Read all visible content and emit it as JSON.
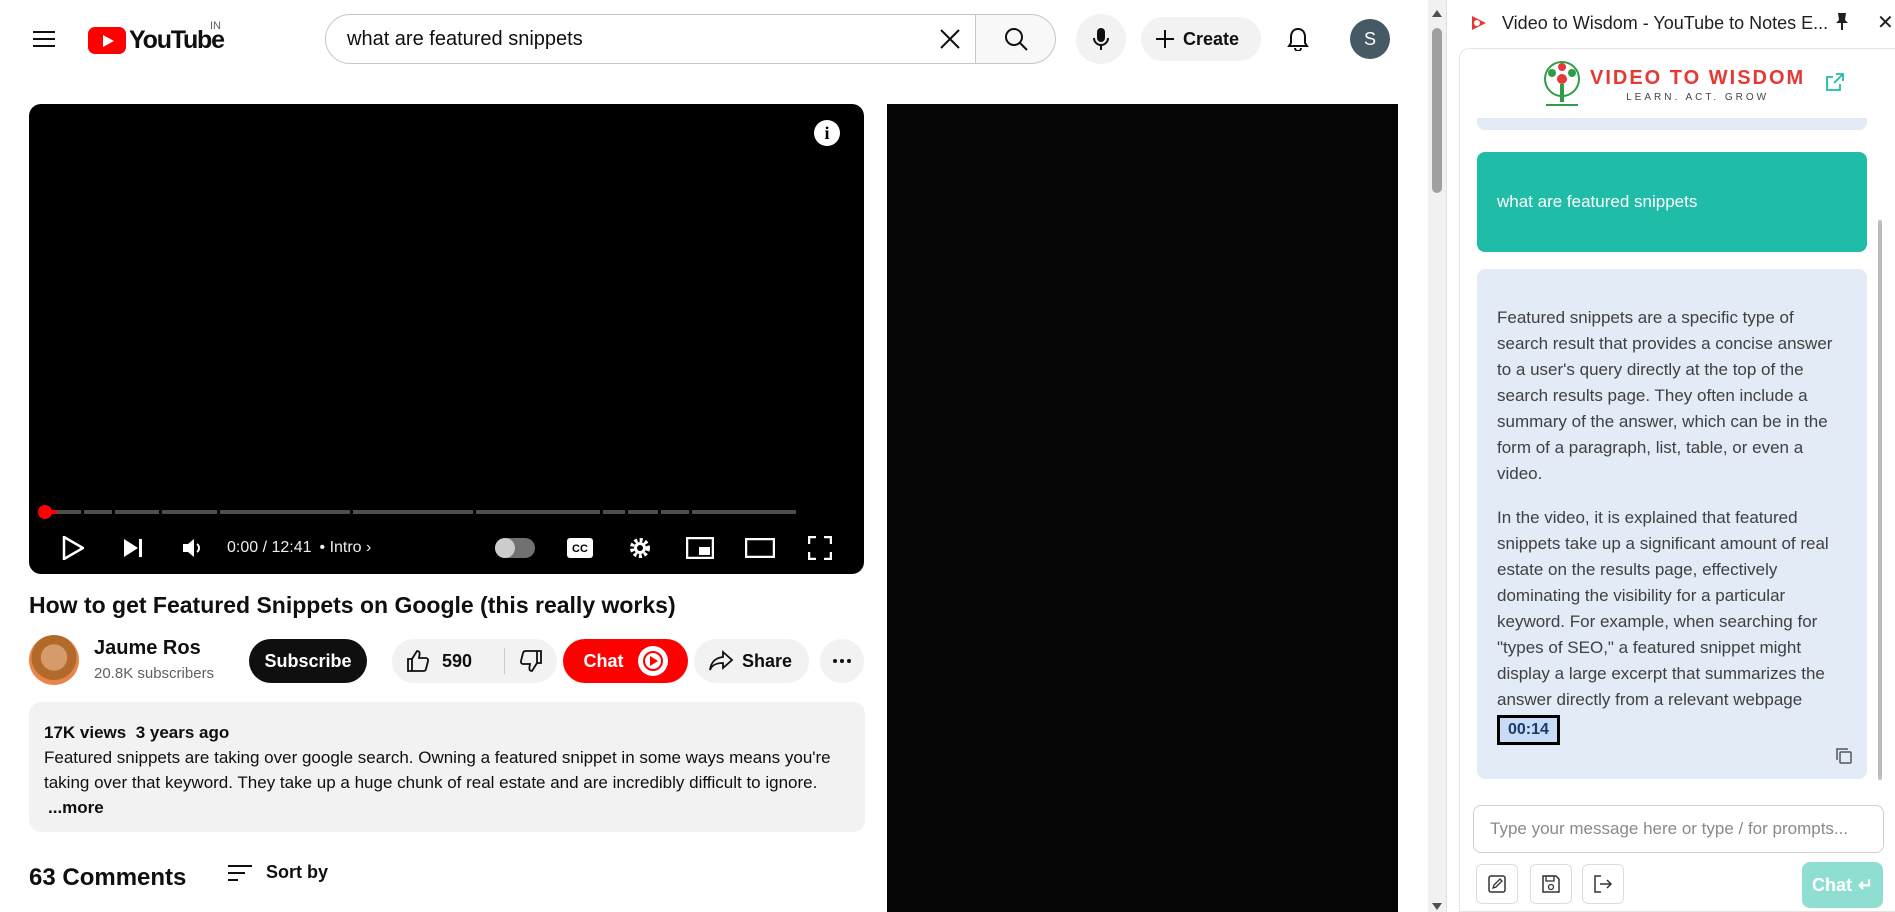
{
  "youtube": {
    "logo_text": "YouTube",
    "country_code": "IN",
    "search": {
      "value": "what are featured snippets"
    },
    "create_label": "Create",
    "account_initial": "S",
    "player": {
      "time": "0:00 / 12:41",
      "chapter": "Intro",
      "progress_fraction": 0.0
    },
    "video": {
      "title": "How to get Featured Snippets on Google (this really works)",
      "channel": "Jaume Ros",
      "subscribers": "20.8K subscribers",
      "subscribe_label": "Subscribe",
      "likes": "590",
      "chat_label": "Chat",
      "share_label": "Share"
    },
    "description": {
      "views": "17K views",
      "age": "3 years ago",
      "text": "Featured snippets are taking over google search. Owning a featured snippet in some ways means you're taking over that keyword. They take up a huge chunk of real estate and are incredibly difficult to ignore.",
      "more_label": "...more"
    },
    "comments": {
      "count_label": "63 Comments",
      "sort_label": "Sort by"
    }
  },
  "extension": {
    "window_title": "Video to Wisdom - YouTube to Notes E...",
    "brand_name": "VIDEO TO WISDOM",
    "brand_tagline": "LEARN. ACT. GROW",
    "user_message": "what are featured snippets",
    "ai_paragraphs": [
      "Featured snippets are a specific type of search result that provides a concise answer to a user's query directly at the top of the search results page. They often include a summary of the answer, which can be in the form of a paragraph, list, table, or even a video.",
      "In the video, it is explained that featured snippets take up a significant amount of real estate on the results page, effectively dominating the visibility for a particular keyword. For example, when searching for \"types of SEO,\" a featured snippet might display a large excerpt that summarizes the answer directly from a relevant webpage"
    ],
    "timestamp": "00:14",
    "input_placeholder": "Type your message here or type / for prompts...",
    "send_label": "Chat"
  },
  "colors": {
    "youtube_red": "#ff0000",
    "user_bubble": "#1fbca7",
    "ai_bubble": "#e3ebf7",
    "brand_red": "#e53935",
    "send_button": "#8fded2"
  }
}
